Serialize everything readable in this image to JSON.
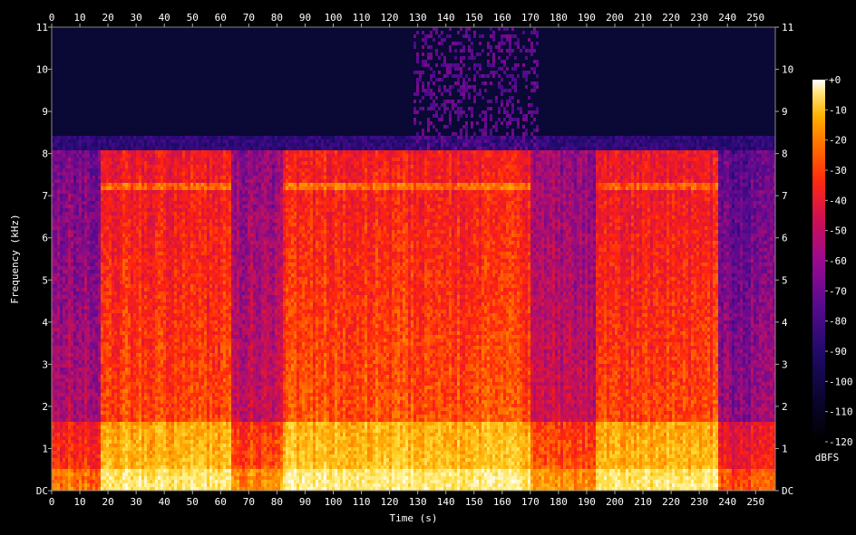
{
  "chart_data": {
    "type": "heatmap",
    "title": "",
    "xlabel": "Time (s)",
    "ylabel": "Frequency (kHz)",
    "xlim": [
      0,
      257
    ],
    "ylim": [
      0,
      11
    ],
    "x_ticks": [
      0,
      10,
      20,
      30,
      40,
      50,
      60,
      70,
      80,
      90,
      100,
      110,
      120,
      130,
      140,
      150,
      160,
      170,
      180,
      190,
      200,
      210,
      220,
      230,
      240,
      250
    ],
    "y_ticks": [
      {
        "value": 0,
        "label": "DC"
      },
      {
        "value": 1,
        "label": "1"
      },
      {
        "value": 2,
        "label": "2"
      },
      {
        "value": 3,
        "label": "3"
      },
      {
        "value": 4,
        "label": "4"
      },
      {
        "value": 5,
        "label": "5"
      },
      {
        "value": 6,
        "label": "6"
      },
      {
        "value": 7,
        "label": "7"
      },
      {
        "value": 8,
        "label": "8"
      },
      {
        "value": 9,
        "label": "9"
      },
      {
        "value": 10,
        "label": "10"
      },
      {
        "value": 11,
        "label": "11"
      }
    ],
    "colorbar": {
      "label": "dBFS",
      "range": [
        -120,
        0
      ],
      "ticks": [
        {
          "value": 0,
          "label": "+0"
        },
        {
          "value": -10,
          "label": "-10"
        },
        {
          "value": -20,
          "label": "-20"
        },
        {
          "value": -30,
          "label": "-30"
        },
        {
          "value": -40,
          "label": "-40"
        },
        {
          "value": -50,
          "label": "-50"
        },
        {
          "value": -60,
          "label": "-60"
        },
        {
          "value": -70,
          "label": "-70"
        },
        {
          "value": -80,
          "label": "-80"
        },
        {
          "value": -90,
          "label": "-90"
        },
        {
          "value": -100,
          "label": "-100"
        },
        {
          "value": -110,
          "label": "-110"
        },
        {
          "value": -120,
          "label": "-120"
        }
      ]
    },
    "segments": [
      {
        "t": [
          0,
          17
        ],
        "cutoff_khz": 8.0,
        "level_dbfs": -75
      },
      {
        "t": [
          17,
          63
        ],
        "cutoff_khz": 8.0,
        "level_dbfs": -50
      },
      {
        "t": [
          63,
          82
        ],
        "cutoff_khz": 8.0,
        "level_dbfs": -70
      },
      {
        "t": [
          82,
          170
        ],
        "cutoff_khz": 8.0,
        "level_dbfs": -48
      },
      {
        "t": [
          170,
          193
        ],
        "cutoff_khz": 8.0,
        "level_dbfs": -70
      },
      {
        "t": [
          193,
          236
        ],
        "cutoff_khz": 8.0,
        "level_dbfs": -50
      },
      {
        "t": [
          236,
          257
        ],
        "cutoff_khz": 8.0,
        "level_dbfs": -80
      }
    ],
    "high_band_burst": {
      "t": [
        128,
        172
      ],
      "f_khz": [
        8,
        11
      ],
      "level_dbfs": -85
    },
    "horizontal_line_khz": 7.2,
    "background_level_dbfs": -112
  }
}
